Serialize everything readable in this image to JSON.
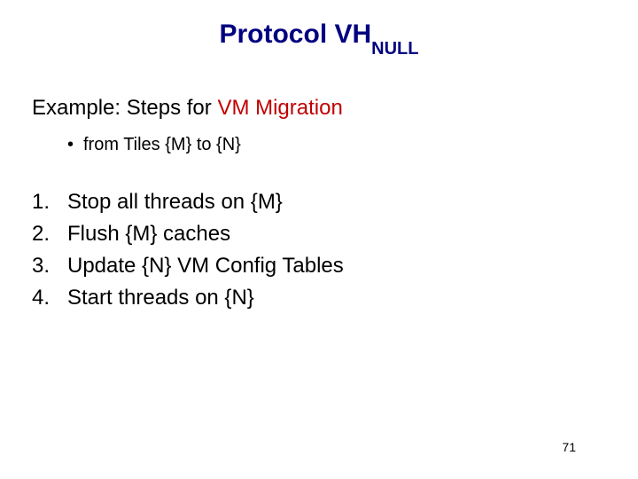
{
  "title": {
    "main": "Protocol VH",
    "subscript": "NULL"
  },
  "example": {
    "prefix": "Example:  Steps for ",
    "highlight": "VM Migration"
  },
  "bullet": {
    "text": "from Tiles {M} to {N}"
  },
  "steps": [
    {
      "num": "1.",
      "text": "Stop all threads on {M}"
    },
    {
      "num": "2.",
      "text": "Flush {M} caches"
    },
    {
      "num": "3.",
      "text": "Update {N} VM Config Tables"
    },
    {
      "num": "4.",
      "text": "Start threads on {N}"
    }
  ],
  "slide_number": "71"
}
